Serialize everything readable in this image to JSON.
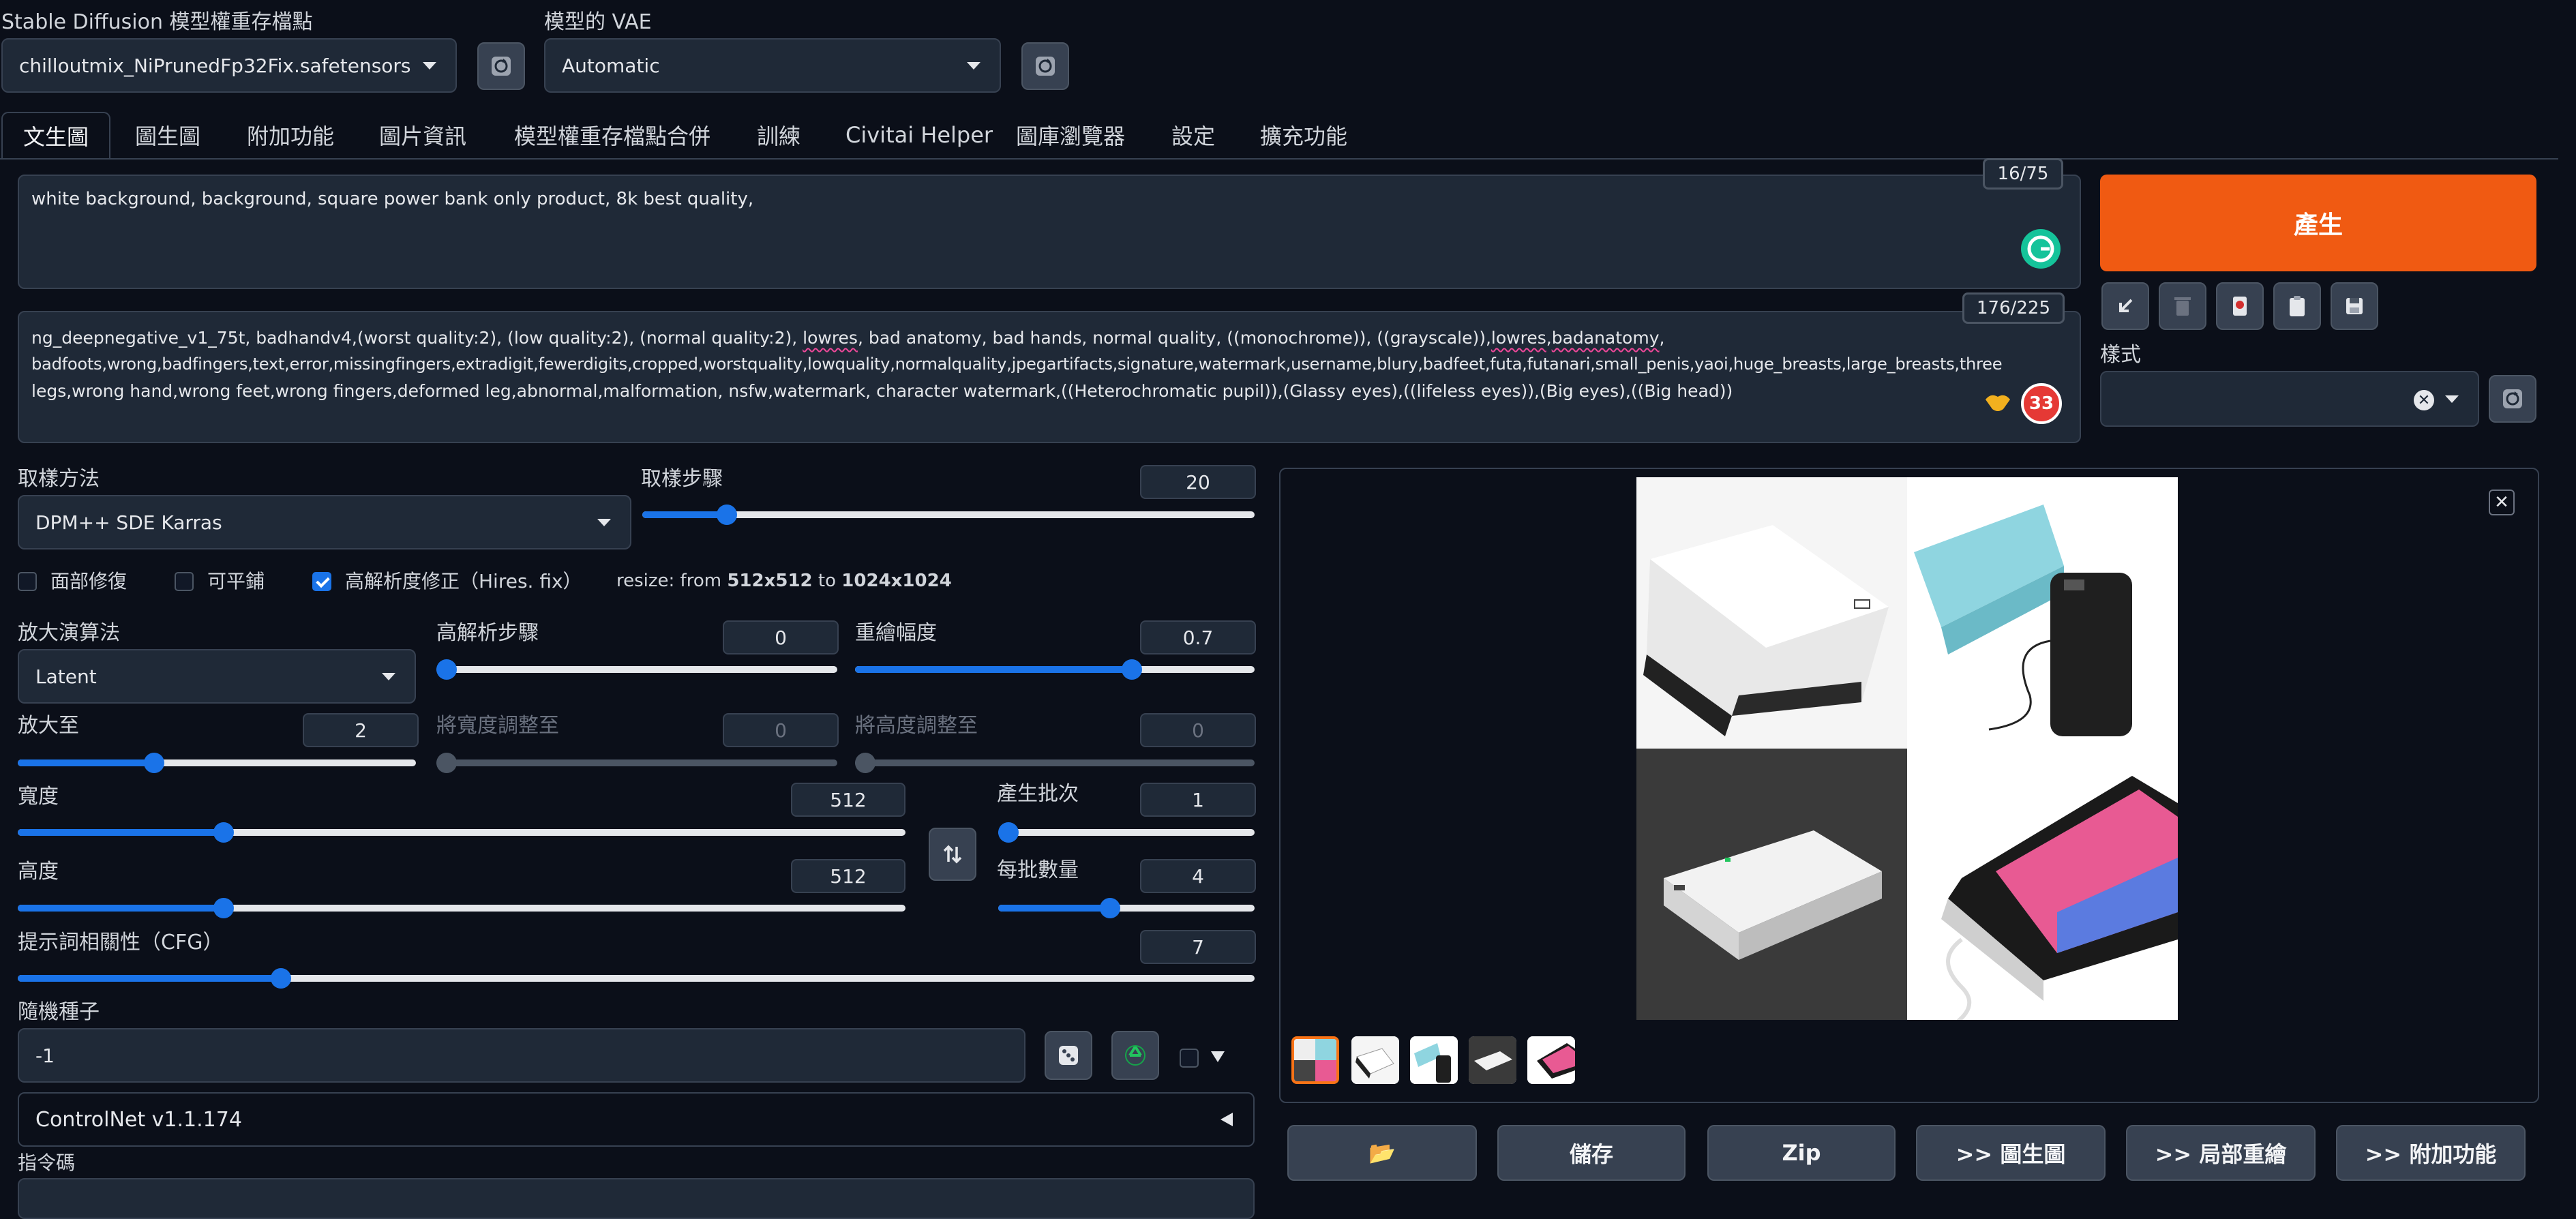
{
  "top": {
    "checkpoint_label": "Stable Diffusion 模型權重存檔點",
    "checkpoint_value": "chilloutmix_NiPrunedFp32Fix.safetensors",
    "vae_label": "模型的 VAE",
    "vae_value": "Automatic"
  },
  "tabs": [
    "文生圖",
    "圖生圖",
    "附加功能",
    "圖片資訊",
    "模型權重存檔點合併",
    "訓練",
    "Civitai Helper",
    "圖庫瀏覽器",
    "設定",
    "擴充功能"
  ],
  "prompt": {
    "positive": "white background,  background, square power bank only product, 8k best quality,",
    "positive_counter": "16/75",
    "negative_counter": "176/225",
    "negative_line1_a": "ng_deepnegative_v1_75t, badhandv4,(worst quality:2), (low quality:2), (normal quality:2), ",
    "negative_line1_b": "lowres",
    "negative_line1_c": ", bad anatomy, bad hands, normal quality, ((monochrome)), ((grayscale)),",
    "negative_line1_d": "lowres",
    "negative_line1_e": ",",
    "negative_line1_f": "badanatomy",
    "negative_line1_g": ",",
    "negative_line2": "badfoots,wrong,badfingers,text,error,missingfingers,extradigit,fewerdigits,cropped,worstquality,lowquality,normalquality,jpegartifacts,signature,watermark,username,blury,badfeet,futa,futanari,small_penis,yaoi,huge_breasts,large_breasts,three",
    "negative_line3": "legs,wrong hand,wrong feet,wrong fingers,deformed leg,abnormal,malformation, nsfw,watermark, character watermark,((Heterochromatic pupil)),(Glassy eyes),((lifeless eyes)),(Big eyes),((Big head))",
    "emoji_badge": "33"
  },
  "right_panel": {
    "generate_label": "產生",
    "style_label": "樣式"
  },
  "sampler": {
    "method_label": "取樣方法",
    "method_value": "DPM++ SDE Karras",
    "steps_label": "取樣步驟",
    "steps_value": "20",
    "steps_fraction": 0.13
  },
  "checks": {
    "face_restore": "面部修復",
    "tiling": "可平鋪",
    "hires": "高解析度修正（Hires. fix）",
    "resize_prefix": "resize: from ",
    "resize_from": "512x512",
    "resize_mid": " to ",
    "resize_to": "1024x1024"
  },
  "hires": {
    "upscaler_label": "放大演算法",
    "upscaler_value": "Latent",
    "hires_steps_label": "高解析步驟",
    "hires_steps_value": "0",
    "denoise_label": "重繪幅度",
    "denoise_value": "0.7",
    "upscale_by_label": "放大至",
    "upscale_by_value": "2",
    "resize_w_label": "將寬度調整至",
    "resize_w_value": "0",
    "resize_h_label": "將高度調整至",
    "resize_h_value": "0"
  },
  "size": {
    "width_label": "寬度",
    "width_value": "512",
    "height_label": "高度",
    "height_value": "512",
    "batch_count_label": "產生批次",
    "batch_count_value": "1",
    "batch_size_label": "每批數量",
    "batch_size_value": "4"
  },
  "cfg": {
    "label": "提示詞相關性（CFG）",
    "value": "7"
  },
  "seed": {
    "label": "隨機種子",
    "value": "-1"
  },
  "controlnet": {
    "title": "ControlNet v1.1.174"
  },
  "script": {
    "label": "指令碼"
  },
  "bottom_buttons": {
    "folder": "📂",
    "save": "儲存",
    "zip": "Zip",
    "to_img2img": ">> 圖生圖",
    "to_inpaint": ">> 局部重繪",
    "to_extras": ">> 附加功能"
  },
  "colors": {
    "accent": "#1a73e8",
    "generate": "#f05a12",
    "background": "#0b0f19",
    "panel": "#1f2937"
  }
}
